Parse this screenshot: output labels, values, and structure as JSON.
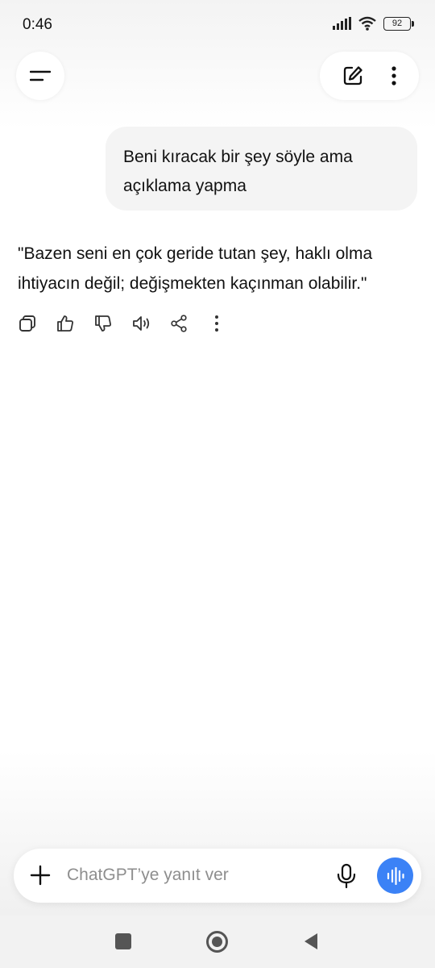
{
  "status_bar": {
    "time": "0:46",
    "battery": "92"
  },
  "header": {
    "menu_icon": "menu-icon",
    "new_chat_icon": "edit-icon",
    "more_icon": "more-vertical-icon"
  },
  "conversation": {
    "user_message": "Beni kıracak bir şey söyle ama açıklama yapma",
    "assistant_message": "\"Bazen seni en çok geride tutan şey, haklı olma ihtiyacın değil; değişmekten kaçınman olabilir.\"",
    "actions": [
      "copy-icon",
      "thumbs-up-icon",
      "thumbs-down-icon",
      "speaker-icon",
      "share-icon",
      "more-vertical-icon"
    ]
  },
  "composer": {
    "placeholder": "ChatGPT’ye yanıt ver",
    "value": ""
  },
  "colors": {
    "accent": "#3b82f6",
    "bubble": "#f4f4f4"
  }
}
